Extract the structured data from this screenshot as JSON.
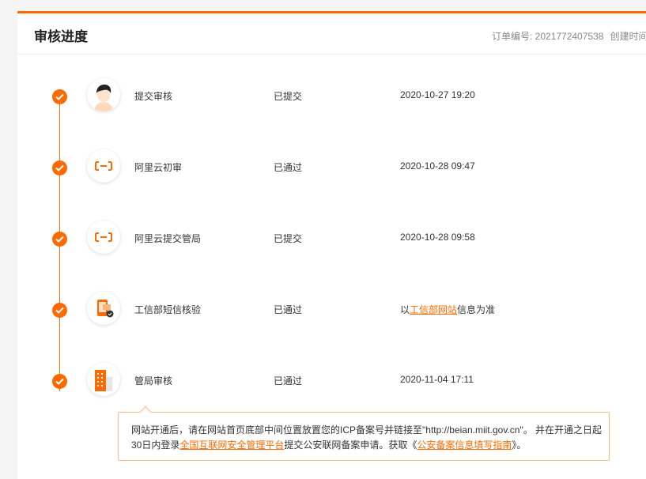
{
  "header": {
    "title": "审核进度",
    "order_label": "订单编号: 2021772407538",
    "created_label": "创建时间"
  },
  "steps": [
    {
      "name": "提交审核",
      "status": "已提交",
      "time": "2020-10-27 19:20",
      "icon": "user-avatar-icon"
    },
    {
      "name": "阿里云初审",
      "status": "已通过",
      "time": "2020-10-28 09:47",
      "icon": "aliyun-logo-icon"
    },
    {
      "name": "阿里云提交管局",
      "status": "已提交",
      "time": "2020-10-28 09:58",
      "icon": "aliyun-logo-icon"
    },
    {
      "name": "工信部短信核验",
      "status": "已通过",
      "time_prefix": "以",
      "time_link": "工信部网站",
      "time_suffix": "信息为准",
      "icon": "phone-sms-icon"
    },
    {
      "name": "管局审核",
      "status": "已通过",
      "time": "2020-11-04 17:11",
      "icon": "building-icon"
    }
  ],
  "tip": {
    "part1": "网站开通后，请在网站首页底部中间位置放置您的ICP备案号并链接至\"http://beian.miit.gov.cn\"。 并在开通之日起30日内登录",
    "link1": "全国互联网安全管理平台",
    "part2": "提交公安联网备案申请。获取《",
    "link2": "公安备案信息填写指南",
    "part3": "》。"
  },
  "colors": {
    "accent": "#ff6a00",
    "tip_border": "#ffb888"
  }
}
